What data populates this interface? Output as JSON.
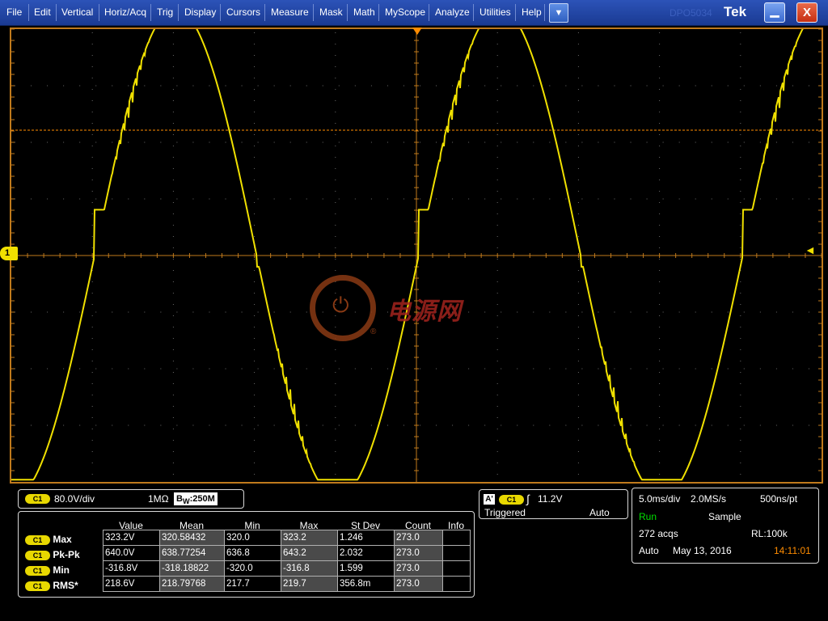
{
  "menu": {
    "items": [
      "File",
      "Edit",
      "Vertical",
      "Horiz/Acq",
      "Trig",
      "Display",
      "Cursors",
      "Measure",
      "Mask",
      "Math",
      "MyScope",
      "Analyze",
      "Utilities",
      "Help"
    ],
    "dropdown_icon": "chevron-down-icon",
    "faint_text": "DPO5034",
    "brand": "Tek",
    "minimize_icon": "minimize-icon",
    "close_label": "X"
  },
  "display": {
    "channel_marker": "1",
    "trace_color": "#f0e000",
    "grid_color": "#c07a1c",
    "waveform": {
      "description": "modified sine with stepped switching transients",
      "period_ms": 20,
      "time_per_div_ms": 5,
      "volts_per_div": 80,
      "peak_v": 323.2,
      "min_v": -316.8,
      "trigger_level_v": 11.2
    }
  },
  "watermark": {
    "text": "电源网",
    "reg_mark": "®",
    "logo_icon": "plug-icon"
  },
  "channel": {
    "badge": "C1",
    "scale": "80.0V/div",
    "impedance": "1MΩ",
    "bw_prefix": "B",
    "bw_sub": "W",
    "bandwidth": ":250M"
  },
  "measurements": {
    "columns": [
      "Value",
      "Mean",
      "Min",
      "Max",
      "St Dev",
      "Count",
      "Info"
    ],
    "rows": [
      {
        "badge": "C1",
        "label": "Max",
        "values": [
          "323.2V",
          "320.58432",
          "320.0",
          "323.2",
          "1.246",
          "273.0",
          ""
        ]
      },
      {
        "badge": "C1",
        "label": "Pk-Pk",
        "values": [
          "640.0V",
          "638.77254",
          "636.8",
          "643.2",
          "2.032",
          "273.0",
          ""
        ]
      },
      {
        "badge": "C1",
        "label": "Min",
        "values": [
          "-316.8V",
          "-318.18822",
          "-320.0",
          "-316.8",
          "1.599",
          "273.0",
          ""
        ]
      },
      {
        "badge": "C1",
        "label": "RMS*",
        "values": [
          "218.6V",
          "218.79768",
          "217.7",
          "219.7",
          "356.8m",
          "273.0",
          ""
        ]
      }
    ]
  },
  "trigger": {
    "a_label": "A'",
    "badge": "C1",
    "slope_icon": "rising-edge-icon",
    "level": "11.2V",
    "status": "Triggered",
    "mode": "Auto"
  },
  "acquisition": {
    "timebase": "5.0ms/div",
    "sample_rate": "2.0MS/s",
    "resolution": "500ns/pt",
    "state": "Run",
    "mode": "Sample",
    "acqs": "272 acqs",
    "record_length": "RL:100k",
    "trigger_mode": "Auto",
    "date": "May 13, 2016",
    "time": "14:11:01",
    "run_color": "#00e000",
    "time_color": "#ff8c00"
  }
}
